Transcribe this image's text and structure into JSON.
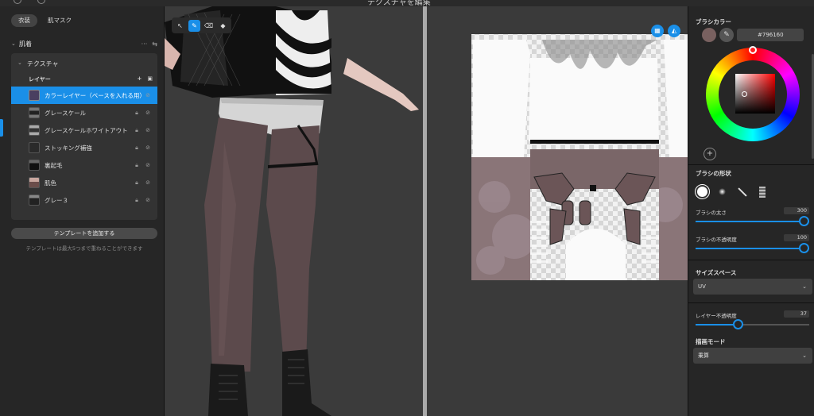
{
  "window": {
    "title": "テクスチャを編集"
  },
  "left": {
    "tabs": [
      "衣装",
      "肌マスク"
    ],
    "section": "肌着",
    "subsection": "テクスチャ",
    "layers_title": "レイヤー",
    "layers": [
      {
        "name": "カラーレイヤー（ベースを入れる用）"
      },
      {
        "name": "グレースケール"
      },
      {
        "name": "グレースケールホワイトアウト"
      },
      {
        "name": "ストッキング補強"
      },
      {
        "name": "裏起毛"
      },
      {
        "name": "肌色"
      },
      {
        "name": "グレー３"
      }
    ],
    "add_template_label": "テンプレートを追加する",
    "template_note": "テンプレートは最大5つまで重ねることができます"
  },
  "right": {
    "brush_color_label": "ブラシカラー",
    "brush_color_hex": "#796160",
    "brush_color": "#796160",
    "brush_shape_label": "ブラシの形状",
    "brush_size_label": "ブラシの太さ",
    "brush_size_value": "300",
    "brush_size_level": 1.0,
    "brush_opacity_label": "ブラシの不透明度",
    "brush_opacity_value": "100",
    "brush_opacity_level": 1.0,
    "size_space_label": "サイズスペース",
    "size_space_value": "UV",
    "layer_opacity_label": "レイヤー不透明度",
    "layer_opacity_value": "37",
    "layer_opacity_level": 0.37,
    "draw_mode_label": "描画モード",
    "draw_mode_value": "乗算"
  },
  "icons": {
    "toolbar3d": [
      "cursor-icon",
      "brush-icon",
      "eraser-icon",
      "fill-icon"
    ],
    "uv_buttons": [
      "grid-icon",
      "mirror-icon"
    ]
  }
}
